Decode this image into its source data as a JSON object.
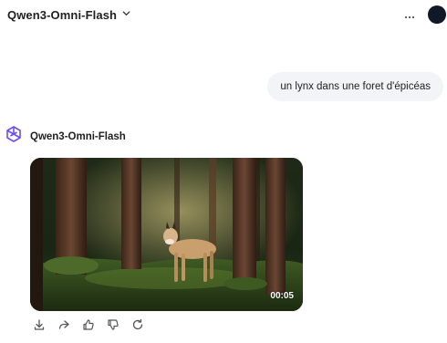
{
  "header": {
    "model_name": "Qwen3-Omni-Flash",
    "chevron_icon": "chevron-down-icon",
    "more_icon": "more-horizontal-icon",
    "avatar_color": "#111827"
  },
  "conversation": {
    "user_message": "un lynx dans une foret d'épicéas",
    "assistant": {
      "name": "Qwen3-Omni-Flash",
      "logo_icon": "qwen-logo-icon",
      "video": {
        "duration": "00:05",
        "content": "lynx standing in a spruce forest"
      },
      "actions": [
        "download-icon",
        "share-icon",
        "thumbs-up-icon",
        "thumbs-down-icon",
        "regenerate-icon"
      ]
    }
  },
  "colors": {
    "brand_purple": "#6c4df5",
    "bubble_bg": "#f3f4f7",
    "text": "#1f1f1f",
    "icon_gray": "#555555"
  }
}
